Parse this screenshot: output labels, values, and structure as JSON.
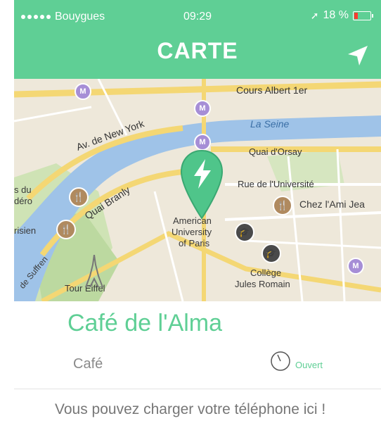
{
  "status_bar": {
    "carrier": "Bouygues",
    "time": "09:29",
    "battery": "18 %",
    "battery_level_percent": 18,
    "location_icon": "location-arrow-icon"
  },
  "header": {
    "title": "CARTE",
    "nav_icon": "navigation-arrow-icon"
  },
  "map": {
    "labels": {
      "cours_albert": "Cours Albert 1er",
      "la_seine": "La Seine",
      "quai_orsay": "Quai d'Orsay",
      "av_new_york": "Av. de New York",
      "rue_universite": "Rue de l'Université",
      "quai_branly": "Quai Branly",
      "chez_ami": "Chez l'Ami Jea",
      "american_univ": "American",
      "american_univ2": "University",
      "american_univ3": "of Paris",
      "college": "Collège",
      "college2": "Jules Romain",
      "tour_eiffel": "Tour Eiffel",
      "suffren": "de Suffren",
      "risien": "risien",
      "s_du": "s du",
      "dero": "déro"
    },
    "pin_icon": "lightning-bolt-icon"
  },
  "place": {
    "name": "Café de l'Alma",
    "type": "Café",
    "status": "Ouvert",
    "status_icon": "clock-icon",
    "description": "Vous pouvez charger votre téléphone ici !"
  },
  "colors": {
    "brand": "#5fcf95",
    "text_grey": "#777777"
  }
}
